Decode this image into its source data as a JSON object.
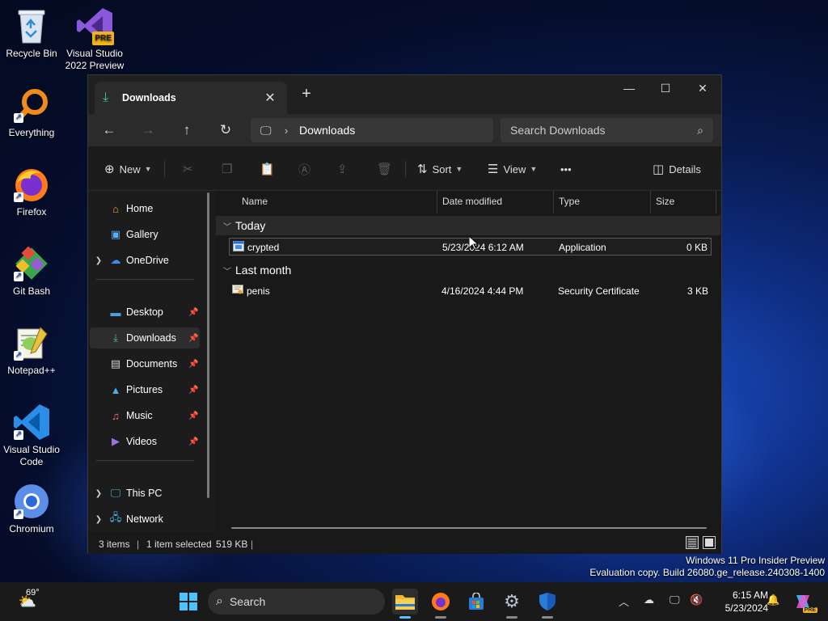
{
  "desktop": {
    "icons": [
      {
        "label": "Recycle Bin"
      },
      {
        "label": "Visual Studio 2022 Preview",
        "badge": "PRE"
      },
      {
        "label": "Everything"
      },
      {
        "label": "Firefox"
      },
      {
        "label": "Git Bash"
      },
      {
        "label": "Notepad++"
      },
      {
        "label": "Visual Studio Code"
      },
      {
        "label": "Chromium"
      }
    ],
    "watermark_line1": "Windows 11 Pro Insider Preview",
    "watermark_line2": "Evaluation copy. Build 26080.ge_release.240308-1400"
  },
  "explorer": {
    "tab_title": "Downloads",
    "address": {
      "path": "Downloads"
    },
    "search": {
      "placeholder": "Search Downloads"
    },
    "toolbar": {
      "new_label": "New",
      "sort_label": "Sort",
      "view_label": "View",
      "more_label": "•••",
      "details_label": "Details"
    },
    "sidebar": {
      "items": [
        {
          "label": "Home",
          "icon": "home-icon"
        },
        {
          "label": "Gallery",
          "icon": "gallery-icon"
        },
        {
          "label": "OneDrive",
          "icon": "cloud-icon"
        },
        {
          "label": "Desktop",
          "icon": "desktop-folder-icon"
        },
        {
          "label": "Downloads",
          "icon": "download-icon"
        },
        {
          "label": "Documents",
          "icon": "document-icon"
        },
        {
          "label": "Pictures",
          "icon": "pictures-icon"
        },
        {
          "label": "Music",
          "icon": "music-icon"
        },
        {
          "label": "Videos",
          "icon": "videos-icon"
        },
        {
          "label": "This PC",
          "icon": "pc-icon"
        },
        {
          "label": "Network",
          "icon": "network-icon"
        }
      ]
    },
    "columns": {
      "name": "Name",
      "date": "Date modified",
      "type": "Type",
      "size": "Size"
    },
    "groups": [
      {
        "label": "Today",
        "files": [
          {
            "name": "crypted",
            "date": "5/23/2024 6:12 AM",
            "type": "Application",
            "size": "0 KB"
          }
        ]
      },
      {
        "label": "Last month",
        "files": [
          {
            "name": "penis",
            "date": "4/16/2024 4:44 PM",
            "type": "Security Certificate",
            "size": "3 KB"
          }
        ]
      }
    ],
    "status": {
      "items": "3 items",
      "selected": "1 item selected",
      "size": "519 KB"
    }
  },
  "taskbar": {
    "weather_temp": "69°",
    "search_label": "Search",
    "time": "6:15 AM",
    "date": "5/23/2024",
    "copilot_badge": "PRE"
  },
  "colors": {
    "accent": "#60c0ff",
    "download_green": "#3fc4a0"
  }
}
